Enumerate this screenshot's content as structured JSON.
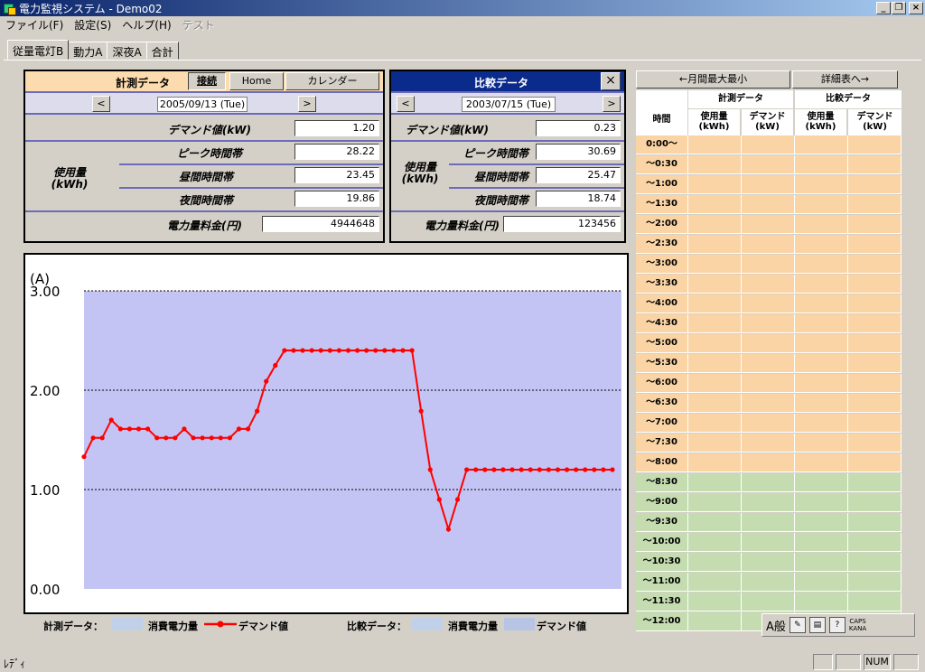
{
  "window": {
    "title": "電力監視システム - Demo02"
  },
  "menu": {
    "file": "ファイル(F)",
    "settings": "設定(S)",
    "help": "ヘルプ(H)",
    "test": "テスト"
  },
  "tabs": [
    "従量電灯B",
    "動力A",
    "深夜A",
    "合計"
  ],
  "measure": {
    "title": "計測データ",
    "btn_connect": "接続",
    "btn_home": "Home",
    "btn_calendar": "カレンダー",
    "prev": "<",
    "next": ">",
    "date": "2005/09/13 (Tue)",
    "demand_label": "デマンド値(kW)",
    "demand": "1.20",
    "usage_label": "使用量\n(kWh)",
    "peak_label": "ピーク時間帯",
    "peak": "28.22",
    "day_label": "昼間時間帯",
    "day": "23.45",
    "night_label": "夜間時間帯",
    "night": "19.86",
    "fee_label": "電力量料金(円)",
    "fee": "4944648"
  },
  "compare": {
    "title": "比較データ",
    "close": "×",
    "prev": "<",
    "next": ">",
    "date": "2003/07/15 (Tue)",
    "demand_label": "デマンド値(kW)",
    "demand": "0.23",
    "usage_label": "使用量\n(kWh)",
    "peak_label": "ピーク時間帯",
    "peak": "30.69",
    "day_label": "昼間時間帯",
    "day": "25.47",
    "night_label": "夜間時間帯",
    "night": "18.74",
    "fee_label": "電力量料金(円)",
    "fee": "123456"
  },
  "chart_data": {
    "type": "line",
    "ylabel": "(A)",
    "ylim": [
      0,
      3
    ],
    "yticks": [
      "0.00",
      "1.00",
      "2.00",
      "3.00"
    ],
    "grid": true,
    "series": [
      {
        "name": "デマンド値",
        "color": "#ff0000",
        "values": [
          1.33,
          1.52,
          1.52,
          1.7,
          1.61,
          1.61,
          1.61,
          1.61,
          1.52,
          1.52,
          1.52,
          1.61,
          1.52,
          1.52,
          1.52,
          1.52,
          1.52,
          1.61,
          1.61,
          1.79,
          2.09,
          2.25,
          2.4,
          2.4,
          2.4,
          2.4,
          2.4,
          2.4,
          2.4,
          2.4,
          2.4,
          2.4,
          2.4,
          2.4,
          2.4,
          2.4,
          2.4,
          1.79,
          1.2,
          0.9,
          0.6,
          0.9,
          1.2,
          1.2,
          1.2,
          1.2,
          1.2,
          1.2,
          1.2,
          1.2,
          1.2,
          1.2,
          1.2,
          1.2,
          1.2,
          1.2,
          1.2,
          1.2,
          1.2
        ]
      }
    ]
  },
  "legend": {
    "measure_label": "計測データ：",
    "compare_label": "比較データ：",
    "consumption": "消費電力量",
    "demand": "デマンド値",
    "consumption2": "消費電力量",
    "demand2": "デマンド値"
  },
  "table": {
    "btn_prev": "←月間最大最小",
    "btn_next": "詳細表へ→",
    "grp_measure": "計測データ",
    "grp_compare": "比較データ",
    "col_time": "時間",
    "col_usage": "使用量\n(kWh)",
    "col_demand": "デマンド\n(kW)",
    "col_usage2": "使用量\n(kWh)",
    "col_demand2": "デマンド\n(kW)",
    "rows": [
      "0:00～",
      "～0:30",
      "～1:00",
      "～1:30",
      "～2:00",
      "～2:30",
      "～3:00",
      "～3:30",
      "～4:00",
      "～4:30",
      "～5:00",
      "～5:30",
      "～6:00",
      "～6:30",
      "～7:00",
      "～7:30",
      "～8:00",
      "～8:30",
      "～9:00",
      "～9:30",
      "～10:00",
      "～10:30",
      "～11:00",
      "～11:30",
      "～12:00"
    ],
    "color_night": "#fad4a4",
    "color_day": "#c4dcb0"
  },
  "status": {
    "text": "ﾚﾃﾞｨ",
    "num": "NUM"
  },
  "ime": {
    "mode": "A般",
    "caps": "CAPS",
    "kana": "KANA"
  }
}
